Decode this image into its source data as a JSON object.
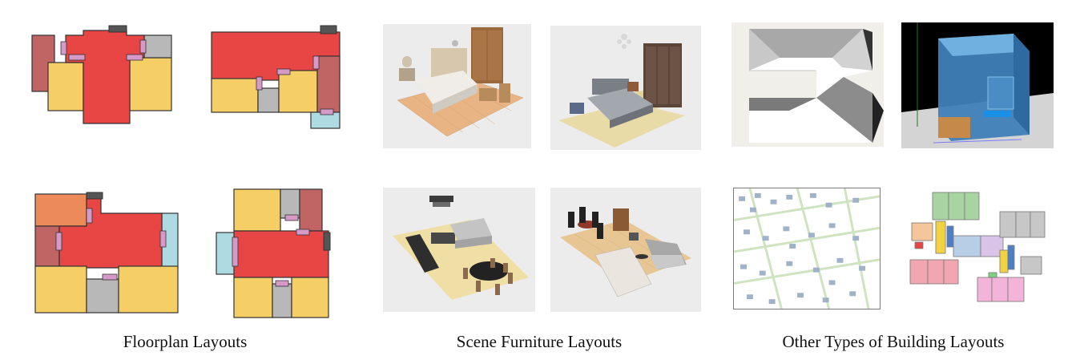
{
  "captions": {
    "floorplan": "Floorplan Layouts",
    "furniture": "Scene Furniture Layouts",
    "other": "Other Types of Building Layouts"
  },
  "colors": {
    "living_room": "#e84545",
    "bedroom": "#f5cf66",
    "bathroom": "#b8b8b8",
    "balcony": "#aedbe2",
    "kitchen": "#c06464",
    "study": "#ec8a5a",
    "door": "#d59ac8",
    "entrance": "#555555",
    "floor_rug": "#e8d9a8",
    "sky_night": "#000000",
    "glass_volume": "#5aa6d6"
  },
  "icons": {
    "bedroom_scene_1": "bedroom-3d-render",
    "bedroom_scene_2": "bedroom-3d-render",
    "living_scene_1": "living-room-3d-render",
    "living_scene_2": "living-room-3d-render",
    "roof": "roof-model-icon",
    "massing": "building-massing-icon",
    "city": "city-block-map-icon",
    "office": "office-floorplan-icon"
  }
}
